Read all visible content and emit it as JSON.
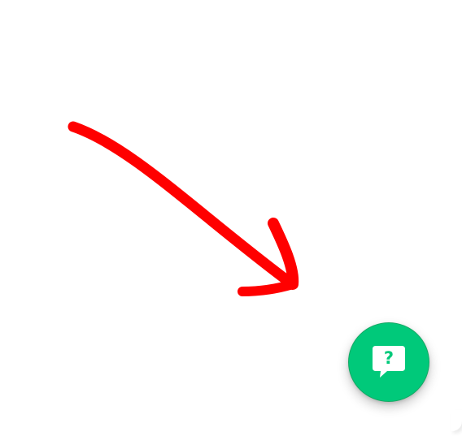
{
  "help_widget": {
    "glyph": "?",
    "icon": "chat-question-icon",
    "button_color": "#00c97a",
    "glyph_color": "#00c97a",
    "bubble_color": "#ffffff"
  },
  "annotation": {
    "icon": "hand-drawn-arrow-icon",
    "color": "#ff0000"
  }
}
